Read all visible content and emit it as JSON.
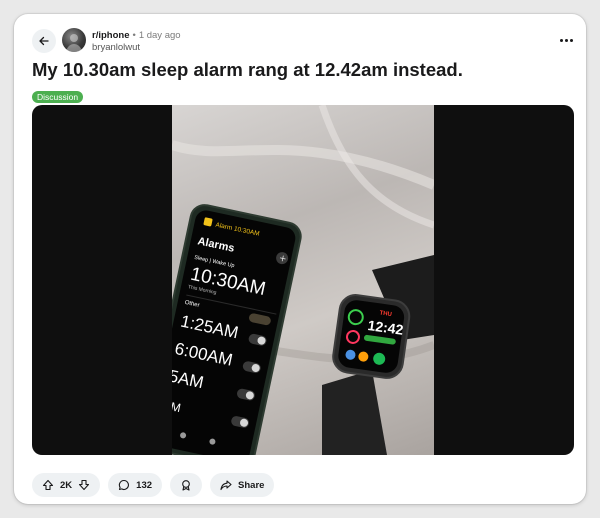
{
  "post": {
    "subreddit": "r/iphone",
    "separator": "•",
    "time_ago": "1 day ago",
    "author": "bryanlolwut",
    "title": "My 10.30am sleep alarm rang at 12.42am instead.",
    "flair": "Discussion",
    "flair_color": "#4caf50"
  },
  "image": {
    "phone_header": "Alarm 10:30AM",
    "phone_title": "Alarms",
    "phone_section": "Sleep | Wake Up",
    "phone_sleep_alarm": "10:30AM",
    "phone_sleep_sub": "This Morning",
    "phone_other": "Other",
    "phone_alarm_1": "1:25AM",
    "phone_alarm_2": "6:00AM",
    "phone_alarm_3": "5AM",
    "phone_alarm_4": "AM",
    "watch_time": "12:42",
    "watch_day": "THU"
  },
  "actions": {
    "votes": "2K",
    "comments": "132",
    "share": "Share"
  },
  "colors": {
    "pill_bg": "#eef1f3",
    "text": "#1a1a1b",
    "muted": "#7c7c7c"
  }
}
